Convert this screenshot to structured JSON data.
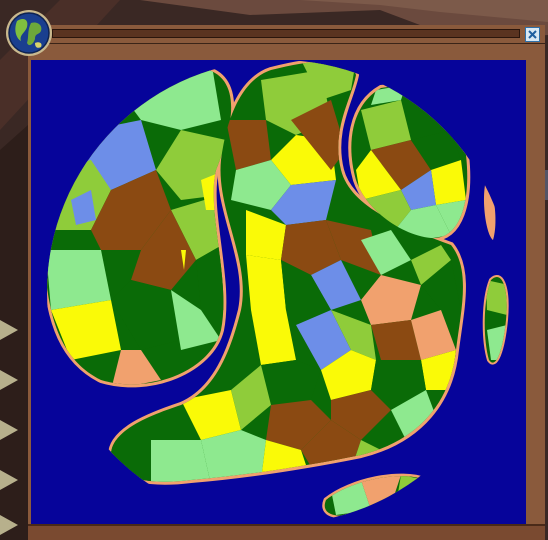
{
  "window": {
    "title": "",
    "close_label": "close"
  },
  "colors": {
    "ocean": "#06049a",
    "coast": "#f1a16e",
    "grass": "#8ee98f",
    "forest": "#0a6b07",
    "plains": "#8fcc3a",
    "desert": "#fafa07",
    "hills": "#8b4a12",
    "lake": "#6d8ee8",
    "frame": "#7a4a30"
  },
  "icons": {
    "globe": "globe-icon",
    "close": "close-icon"
  }
}
